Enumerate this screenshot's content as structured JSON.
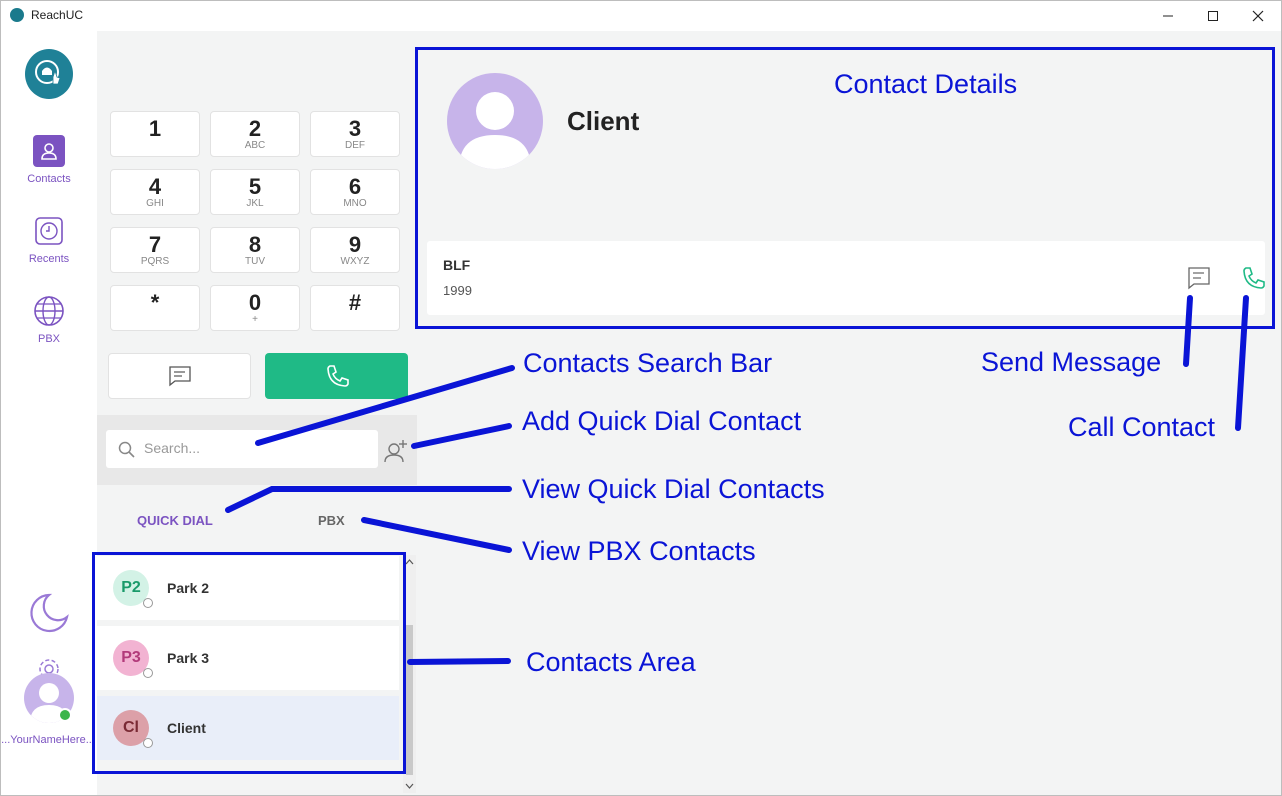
{
  "window": {
    "title": "ReachUC"
  },
  "nav": {
    "items": [
      {
        "label": "Contacts",
        "icon": "person-icon"
      },
      {
        "label": "Recents",
        "icon": "clock-icon"
      },
      {
        "label": "PBX",
        "icon": "globe-icon"
      }
    ],
    "user_name": "...YourNameHere..."
  },
  "dialpad": {
    "keys": [
      {
        "digit": "1",
        "letters": ""
      },
      {
        "digit": "2",
        "letters": "ABC"
      },
      {
        "digit": "3",
        "letters": "DEF"
      },
      {
        "digit": "4",
        "letters": "GHI"
      },
      {
        "digit": "5",
        "letters": "JKL"
      },
      {
        "digit": "6",
        "letters": "MNO"
      },
      {
        "digit": "7",
        "letters": "PQRS"
      },
      {
        "digit": "8",
        "letters": "TUV"
      },
      {
        "digit": "9",
        "letters": "WXYZ"
      },
      {
        "digit": "*",
        "letters": ""
      },
      {
        "digit": "0",
        "letters": "+"
      },
      {
        "digit": "#",
        "letters": ""
      }
    ]
  },
  "search": {
    "placeholder": "Search..."
  },
  "tabs": {
    "quick_dial": "QUICK DIAL",
    "pbx": "PBX"
  },
  "contacts": [
    {
      "initials": "P2",
      "name": "Park 2"
    },
    {
      "initials": "P3",
      "name": "Park 3"
    },
    {
      "initials": "Cl",
      "name": "Client"
    }
  ],
  "details": {
    "name": "Client",
    "number_label": "BLF",
    "number_value": "1999"
  },
  "annotations": {
    "contact_details": "Contact Details",
    "search_bar": "Contacts Search Bar",
    "add_quick_dial": "Add Quick Dial Contact",
    "view_quick_dial": "View Quick Dial Contacts",
    "view_pbx": "View PBX Contacts",
    "contacts_area": "Contacts Area",
    "send_message": "Send Message",
    "call_contact": "Call Contact"
  },
  "colors": {
    "accent": "#7b53c1",
    "call_green": "#1fba86",
    "annotation_blue": "#0a14d6",
    "logo_teal": "#1f8197"
  }
}
